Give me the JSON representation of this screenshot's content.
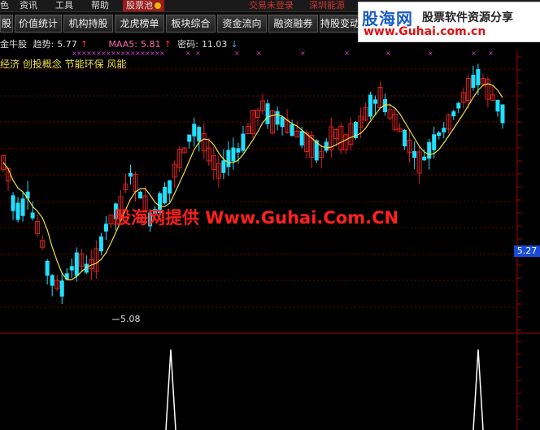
{
  "menu": {
    "items": [
      "色",
      "资讯",
      "工具",
      "帮助"
    ],
    "active": "股票池",
    "status_left": "交易未登录",
    "status_right": "深圳能源"
  },
  "tabs": [
    "股",
    "价值统计",
    "机构持股",
    "龙虎榜单",
    "板块综合",
    "资金流向",
    "融资融券",
    "持股变动"
  ],
  "logo": {
    "main": "股海网",
    "sub": "股票软件资源分享",
    "url": "www.Guhai.com.cn"
  },
  "indicator": {
    "name": "金牛股",
    "trend_label": "趋势:",
    "trend_value": "5.77",
    "maa_label": "MAA5:",
    "maa_value": "5.81",
    "code_label": "密码:",
    "code_value": "11.03"
  },
  "concepts": "经济 创投概念 节能环保 风能",
  "watermark": "股海网提供 Www.Guhai.Com.CN",
  "price_tag": "5.27",
  "low_label": "5.08",
  "colors": {
    "up": "#e02020",
    "down": "#20e0ff",
    "ma": "#f0e040",
    "grid": "#7a0000",
    "tab_bg": "#2a2a2a"
  }
}
